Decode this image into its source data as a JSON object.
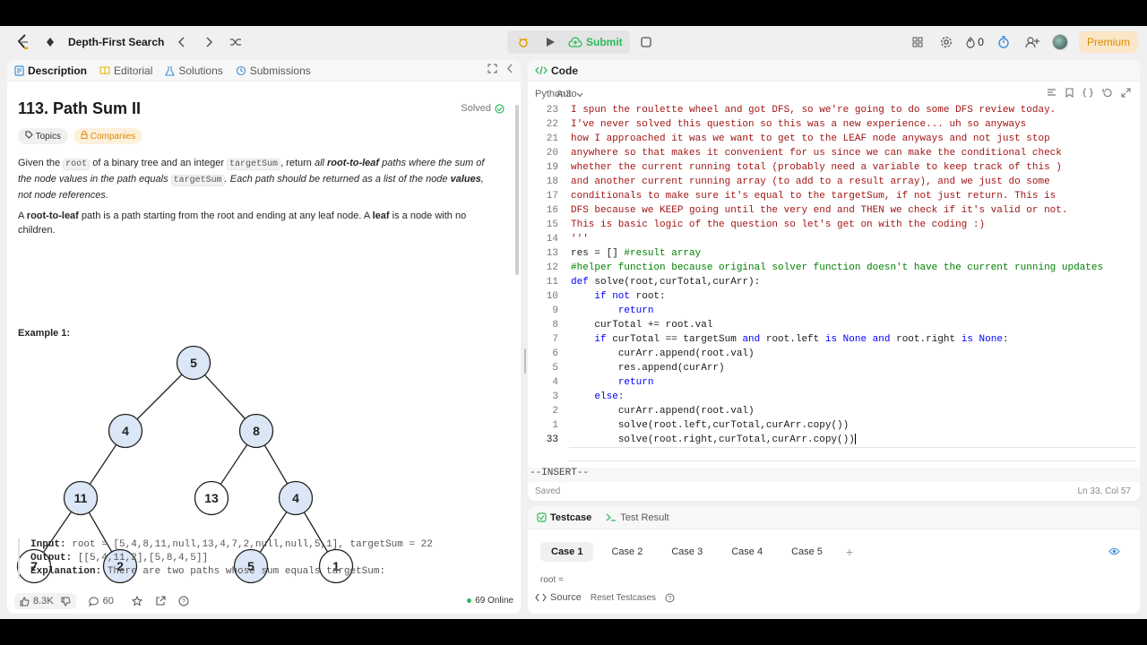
{
  "topbar": {
    "problem_list": "Depth-First Search",
    "submit": "Submit",
    "fire_count": "0",
    "premium": "Premium"
  },
  "left": {
    "tabs": [
      "Description",
      "Editorial",
      "Solutions",
      "Submissions"
    ],
    "title": "113. Path Sum II",
    "solved": "Solved",
    "tag_topics": "Topics",
    "tag_companies": "Companies",
    "para1": {
      "a": "Given the ",
      "c1": "root",
      "b": " of a binary tree and an integer ",
      "c2": "targetSum",
      "c": ", return ",
      "d": "all ",
      "e": "root-to-leaf",
      "f": " paths where the sum of the node values in the path equals ",
      "c3": "targetSum",
      "g": ". Each path should be returned as a list of the node ",
      "h": "values",
      "i": ", not node references."
    },
    "para2": {
      "a": "A ",
      "b": "root-to-leaf",
      "c": " path is a path starting from the root and ending at any leaf node. A ",
      "d": "leaf",
      "e": " is a node with no children."
    },
    "example_title": "Example 1:",
    "tree_nodes": [
      "5",
      "4",
      "8",
      "11",
      "13",
      "4",
      "7",
      "2",
      "5",
      "1"
    ],
    "highlight_color": "#dbe7f7",
    "input_label": "Input:",
    "input_value": "root = [5,4,8,11,null,13,4,7,2,null,null,5,1], targetSum = 22",
    "output_label": "Output:",
    "output_value": "[[5,4,11,2],[5,8,4,5]]",
    "explanation_label": "Explanation:",
    "explanation_value": "There are two paths whose sum equals targetSum:",
    "likes": "8.3K",
    "comments": "60",
    "online": "69 Online"
  },
  "code": {
    "tab": "Code",
    "lang": "Python3",
    "lang_overlay": "Auto",
    "lines": [
      {
        "n": "23",
        "t": "I spun the roulette wheel and got DFS, so we're going to do some DFS review today."
      },
      {
        "n": "22",
        "t": "I've never solved this question so this was a new experience... uh so anyways"
      },
      {
        "n": "21",
        "t": "how I approached it was we want to get to the LEAF node anyways and not just stop"
      },
      {
        "n": "20",
        "t": "anywhere so that makes it convenient for us since we can make the conditional check"
      },
      {
        "n": "19",
        "t": "whether the current running total (probably need a variable to keep track of this )"
      },
      {
        "n": "18",
        "t": "and another current running array (to add to a result array), and we just do some"
      },
      {
        "n": "17",
        "t": "conditionals to make sure it's equal to the targetSum, if not just return. This is"
      },
      {
        "n": "16",
        "t": "DFS because we KEEP going until the very end and THEN we check if it's valid or not."
      },
      {
        "n": "15",
        "t": "This is basic logic of the question so let's get on with the coding :)"
      },
      {
        "n": "14",
        "t": "'''"
      },
      {
        "n": "13",
        "a": "res = [] ",
        "b": "#result array"
      },
      {
        "n": "12",
        "b": "#helper function because original solver function doesn't have the current running updates"
      },
      {
        "n": "11",
        "k": "def",
        "a": " solve(root,curTotal,curArr):"
      },
      {
        "n": "10",
        "ind": "    ",
        "k": "if not",
        "a": " root:"
      },
      {
        "n": "9",
        "ind": "        ",
        "k": "return"
      },
      {
        "n": "8",
        "ind": "    ",
        "a": "curTotal += root.val"
      },
      {
        "n": "7",
        "ind": "    ",
        "k": "if",
        "a": " curTotal == targetSum ",
        "k2": "and",
        "a2": " root.left ",
        "k3": "is None and",
        "a3": " root.right ",
        "k4": "is None",
        "a4": ":"
      },
      {
        "n": "6",
        "ind": "        ",
        "a": "curArr.append(root.val)"
      },
      {
        "n": "5",
        "ind": "        ",
        "a": "res.append(curArr)"
      },
      {
        "n": "4",
        "ind": "        ",
        "k": "return"
      },
      {
        "n": "3",
        "ind": "    ",
        "k": "else",
        "a": ":"
      },
      {
        "n": "2",
        "ind": "        ",
        "a": "curArr.append(root.val)"
      },
      {
        "n": "1",
        "ind": "        ",
        "a": "solve(root.left,curTotal,curArr.copy())"
      },
      {
        "n": "33",
        "ind": "        ",
        "a": "solve(root.right,curTotal,curArr.copy())"
      }
    ],
    "mode": "--INSERT--",
    "saved": "Saved",
    "position": "Ln 33, Col 57"
  },
  "bottom": {
    "tabs": [
      "Testcase",
      "Test Result"
    ],
    "cases": [
      "Case 1",
      "Case 2",
      "Case 3",
      "Case 4",
      "Case 5"
    ],
    "add": "+",
    "root_label": "root =",
    "source": "Source",
    "reset": "Reset Testcases"
  }
}
